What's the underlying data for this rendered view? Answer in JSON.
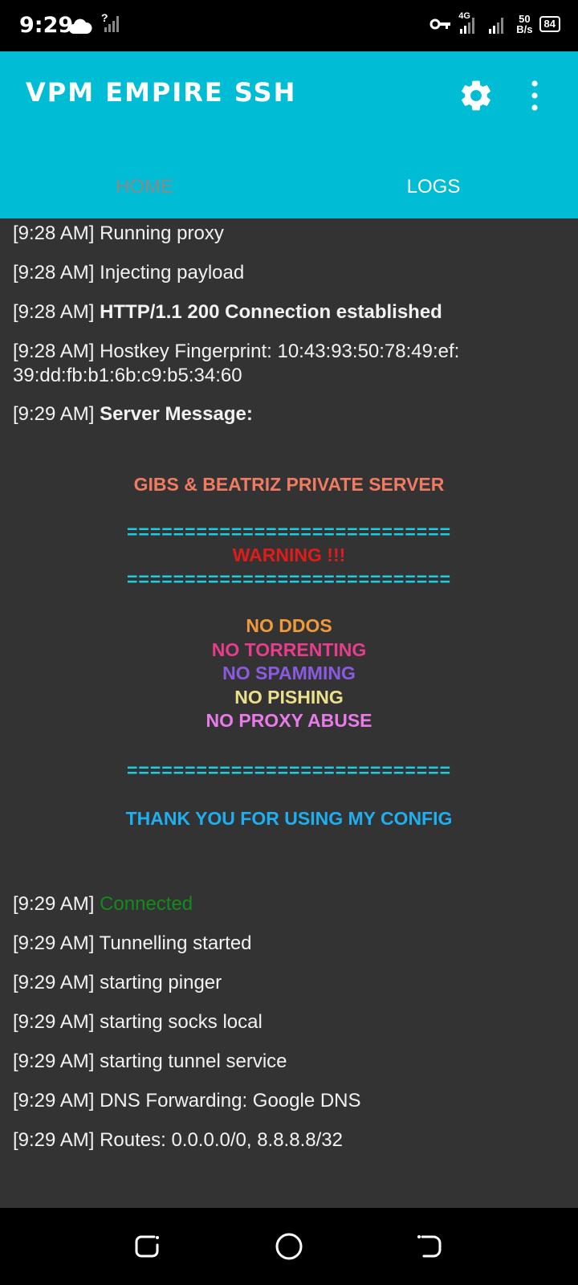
{
  "status_bar": {
    "time": "9:29",
    "signal_unknown": "?",
    "net_label": "4G",
    "speed_value": "50",
    "speed_unit": "B/s",
    "battery": "84"
  },
  "app_bar": {
    "title": "VPM EMPIRE SSH",
    "accent_color": "#00BCD4",
    "tabs": [
      {
        "label": "HOME",
        "active": false
      },
      {
        "label": "LOGS",
        "active": true
      }
    ]
  },
  "logs": {
    "lines": [
      {
        "time": "[9:28 AM]",
        "text": "Running proxy"
      },
      {
        "time": "[9:28 AM]",
        "text": "Injecting payload"
      },
      {
        "time": "[9:28 AM]",
        "text": "HTTP/1.1 200 Connection established"
      },
      {
        "time": "[9:28 AM]",
        "text": "Hostkey Fingerprint: 10:43:93:50:78:49:ef:",
        "text_cont": "39:dd:fb:b1:6b:c9:b5:34:60"
      },
      {
        "time": "[9:29 AM]",
        "text": "Server Message:"
      },
      {
        "time": "[9:29 AM]",
        "text": "Connected"
      },
      {
        "time": "[9:29 AM]",
        "text": "Tunnelling started"
      },
      {
        "time": "[9:29 AM]",
        "text": "starting pinger"
      },
      {
        "time": "[9:29 AM]",
        "text": "starting socks local"
      },
      {
        "time": "[9:29 AM]",
        "text": "starting tunnel service"
      },
      {
        "time": "[9:29 AM]",
        "text": "DNS Forwarding: Google DNS"
      },
      {
        "time": "[9:29 AM]",
        "text": "Routes: 0.0.0.0/0, 8.8.8.8/32"
      }
    ],
    "server_message": {
      "title": "GIBS & BEATRIZ PRIVATE SERVER",
      "separator_1": "============================",
      "warning": "WARNING !!!",
      "separator_2": "============================",
      "rules": [
        {
          "text": "NO DDOS",
          "color": "#f29a3a"
        },
        {
          "text": "NO TORRENTING",
          "color": "#e83c8c"
        },
        {
          "text": "NO SPAMMING",
          "color": "#8a5be0"
        },
        {
          "text": "NO PISHING",
          "color": "#ece08c"
        },
        {
          "text": "NO PROXY ABUSE",
          "color": "#e87be8"
        }
      ],
      "separator_3": "============================",
      "thanks": "THANK YOU FOR USING MY CONFIG",
      "colors": {
        "title": "#f07b62",
        "warning": "#e01b1b",
        "separator": "#19d0e2",
        "thanks": "#1eaff0"
      }
    },
    "connected_color": "#118c1a"
  }
}
